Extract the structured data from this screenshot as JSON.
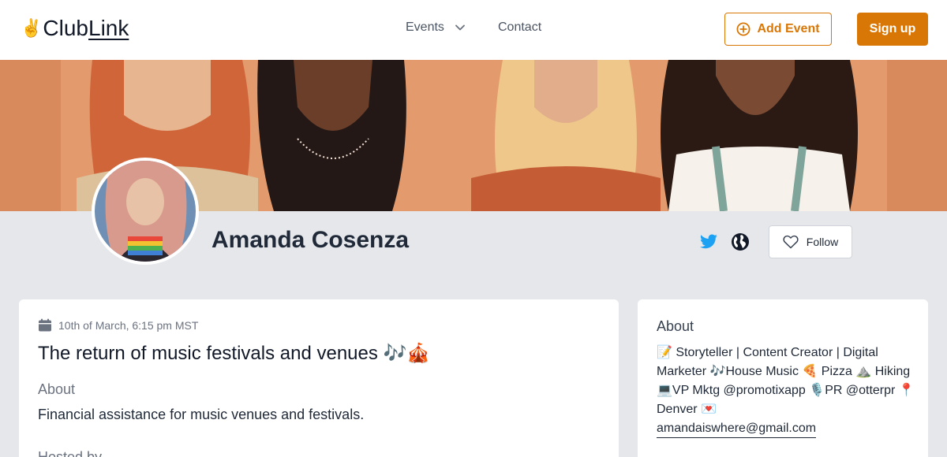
{
  "header": {
    "logo_prefix": "Club",
    "logo_suffix": "Link",
    "logo_icon": "victory-hand-icon",
    "nav": {
      "events_label": "Events",
      "contact_label": "Contact"
    },
    "add_event_label": "Add Event",
    "sign_up_label": "Sign up",
    "accent_color": "#d97706"
  },
  "profile": {
    "name": "Amanda Cosenza",
    "follow_label": "Follow",
    "social_icons": [
      "twitter-icon",
      "globe-icon"
    ]
  },
  "event": {
    "date": "10th of March, 6:15 pm MST",
    "title": "The return of music festivals and venues 🎶🎪",
    "about_label": "About",
    "description": "Financial assistance for music venues and festivals.",
    "hosted_by_label": "Hosted by"
  },
  "about": {
    "title": "About",
    "bio": "📝 Storyteller | Content Creator | Digital Marketer 🎶House Music 🍕 Pizza ⛰️ Hiking 💻VP Mktg @promotixapp 🎙️PR @otterpr 📍Denver 💌",
    "email": "amandaiswhere@gmail.com"
  }
}
